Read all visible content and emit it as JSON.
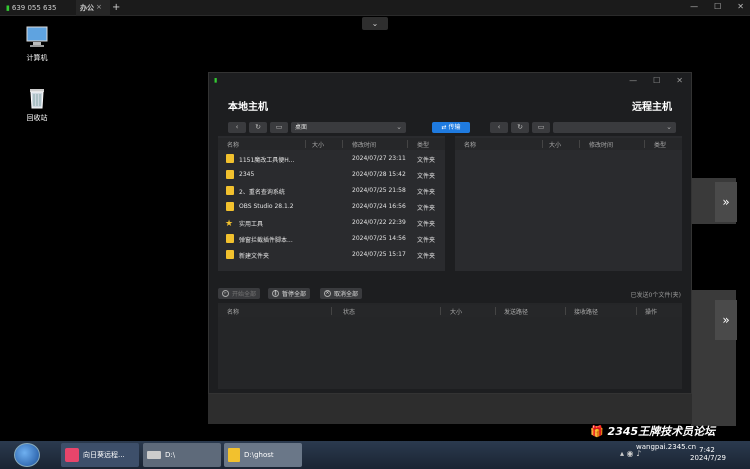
{
  "remote_bar": {
    "tab1_label": "639 055 635",
    "tab2_label": "办公",
    "tab_close": "×",
    "new_tab": "+",
    "win_controls": [
      "—",
      "☐",
      "✕"
    ],
    "dropdown": "⌄"
  },
  "desktop": {
    "icons": [
      {
        "name": "computer",
        "label": "计算机"
      },
      {
        "name": "recycle-bin",
        "label": "回收站"
      }
    ]
  },
  "window": {
    "controls": [
      "—",
      "☐",
      "✕"
    ],
    "local_title": "本地主机",
    "remote_title": "远程主机",
    "transfer_label": "⇄ 传输",
    "local": {
      "path": "桌面",
      "columns": [
        "名称",
        "大小",
        "修改时间",
        "类型"
      ],
      "rows": [
        {
          "name": "1151魔改工具便H...",
          "size": "",
          "time": "2024/07/27 23:11",
          "type": "文件夹",
          "icon": "folder"
        },
        {
          "name": "2345",
          "size": "",
          "time": "2024/07/28 15:42",
          "type": "文件夹",
          "icon": "folder"
        },
        {
          "name": "2、重名查询系统",
          "size": "",
          "time": "2024/07/25 21:58",
          "type": "文件夹",
          "icon": "folder"
        },
        {
          "name": "OBS Studio 28.1.2",
          "size": "",
          "time": "2024/07/24 16:56",
          "type": "文件夹",
          "icon": "folder"
        },
        {
          "name": "实用工具",
          "size": "",
          "time": "2024/07/22 22:39",
          "type": "文件夹",
          "icon": "star"
        },
        {
          "name": "弹窗拦截插件脚本...",
          "size": "",
          "time": "2024/07/25 14:56",
          "type": "文件夹",
          "icon": "folder"
        },
        {
          "name": "新建文件夹",
          "size": "",
          "time": "2024/07/25 15:17",
          "type": "文件夹",
          "icon": "folder"
        }
      ]
    },
    "remote": {
      "path": "",
      "columns": [
        "名称",
        "大小",
        "修改时间",
        "类型"
      ]
    },
    "actions": {
      "start_all": "开始全部",
      "pause_all": "暂停全部",
      "cancel_all": "取消全部",
      "selected_status": "已发送0个文件(夹)"
    },
    "queue_columns": [
      "名称",
      "状态",
      "大小",
      "发送路径",
      "接收路径",
      "操作"
    ]
  },
  "taskbar": {
    "items": [
      {
        "label": "向日葵远程..."
      },
      {
        "label": "D:\\"
      },
      {
        "label": "D:\\ghost"
      }
    ],
    "watermark": "2345王牌技术员论坛",
    "watermark_url": "wangpai.2345.cn",
    "time": "7:42",
    "date": "2024/7/29"
  }
}
